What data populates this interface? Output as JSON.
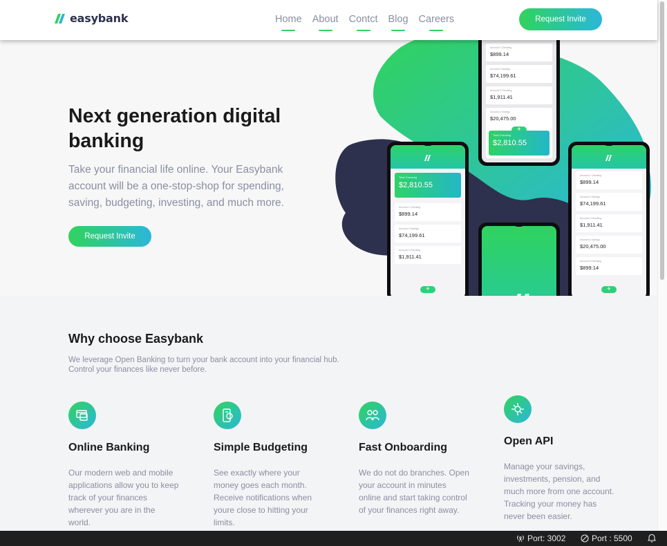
{
  "brand": {
    "name": "easybank",
    "accent_green": "#31d35c",
    "accent_cyan": "#2bb7da",
    "dark": "#2d314d"
  },
  "nav": {
    "items": [
      "Home",
      "About",
      "Contct",
      "Blog",
      "Careers"
    ],
    "cta": "Request Invite"
  },
  "hero": {
    "title": "Next generation digital banking",
    "text": "Take your financial life online. Your Easybank account will be a one-stop-shop for spending, saving, budgeting, investing, and much more.",
    "cta": "Request Invite"
  },
  "phones": {
    "total_label": "Total Checking",
    "total_value": "$2,810.55",
    "accounts": [
      {
        "label": "Account 1 Checking",
        "value": "$899.14"
      },
      {
        "label": "Account 2 Savings",
        "value": "$74,199.61"
      },
      {
        "label": "Account 3 Checking",
        "value": "$1,911.41"
      },
      {
        "label": "Account 4 Savings",
        "value": "$20,475.00"
      },
      {
        "label": "Account 5 Checking",
        "value": "$899.14"
      }
    ]
  },
  "why": {
    "title": "Why choose Easybank",
    "description": "We leverage Open Banking to turn your bank account into your financial hub. Control your finances like never before.",
    "features": [
      {
        "icon": "online-banking-icon",
        "title": "Online Banking",
        "text": "Our modern web and mobile applications allow you to keep track of your finances wherever you are in the world."
      },
      {
        "icon": "budgeting-icon",
        "title": "Simple Budgeting",
        "text": "See exactly where your money goes each month. Receive notifications when youre close to hitting your limits."
      },
      {
        "icon": "onboarding-icon",
        "title": "Fast Onboarding",
        "text": "We do not do branches. Open your account in minutes online and start taking control of your finances right away."
      },
      {
        "icon": "api-icon",
        "title": "Open API",
        "text": "Manage your savings, investments, pension, and much more from one account. Tracking your money has never been easier."
      }
    ]
  },
  "statusbar": {
    "port_live": "Port: 3002",
    "port_off": "Port : 5500"
  }
}
